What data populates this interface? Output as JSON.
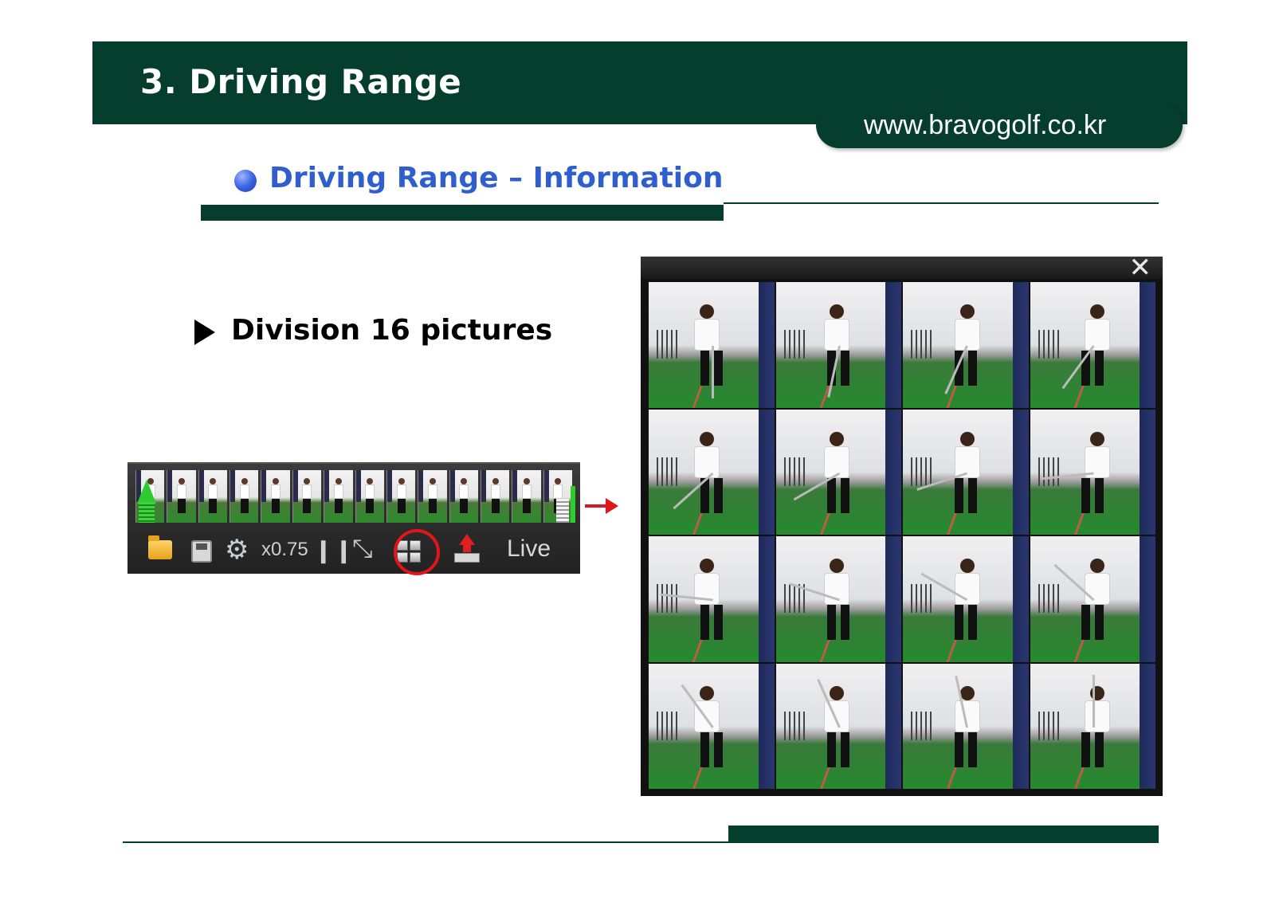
{
  "header": {
    "title": "3. Driving Range",
    "url": "www.bravogolf.co.kr"
  },
  "section": {
    "title": "Driving Range – Information"
  },
  "bullet": {
    "text": "Division 16 pictures"
  },
  "toolbar": {
    "icons": [
      "folder-icon",
      "save-icon",
      "gear-icon",
      "pause-icon",
      "compare-icon",
      "grid-icon",
      "upload-icon"
    ],
    "speed_label": "x0.75",
    "live_label": "Live",
    "highlight_color": "#e0161b"
  },
  "window": {
    "close_icon": "close-icon",
    "photo_count": 16
  },
  "colors": {
    "brand_green": "#053e2d",
    "section_blue": "#2f5fcf",
    "highlight_red": "#e0161b"
  }
}
